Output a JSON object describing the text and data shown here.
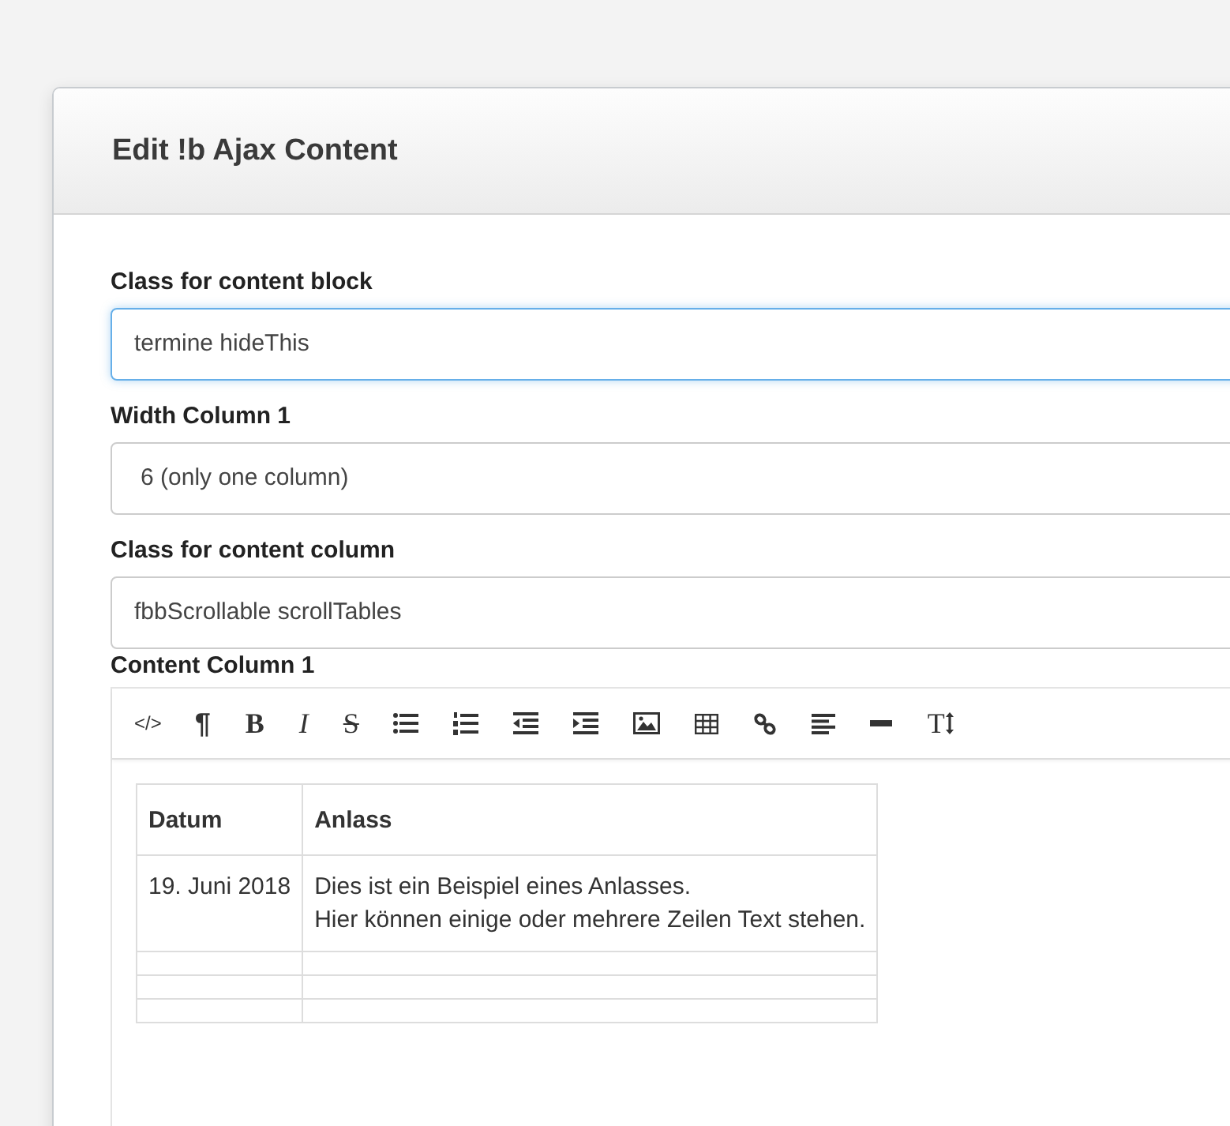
{
  "modal": {
    "title": "Edit !b Ajax Content"
  },
  "fields": [
    {
      "kind": "text",
      "label": "Class for content block",
      "value": "termine hideThis",
      "focused": true
    },
    {
      "kind": "select",
      "label": "Width Column 1",
      "value": "6 (only one column)",
      "focused": false
    },
    {
      "kind": "text",
      "label": "Class for content column",
      "value": "fbbScrollable scrollTables",
      "focused": false
    }
  ],
  "editor": {
    "label": "Content Column 1",
    "toolbar": [
      {
        "kind": "code",
        "label": "</>"
      },
      {
        "kind": "paragraph",
        "label": "¶"
      },
      {
        "kind": "bold",
        "label": "B"
      },
      {
        "kind": "italic",
        "label": "I"
      },
      {
        "kind": "strike",
        "label": "S"
      },
      {
        "kind": "bullet-list"
      },
      {
        "kind": "numbered-list"
      },
      {
        "kind": "outdent"
      },
      {
        "kind": "indent"
      },
      {
        "kind": "image"
      },
      {
        "kind": "table"
      },
      {
        "kind": "link"
      },
      {
        "kind": "align"
      },
      {
        "kind": "rule"
      },
      {
        "kind": "text-height",
        "label": "T"
      }
    ],
    "table": {
      "columns": [
        "Datum",
        "Anlass"
      ],
      "rows": [
        {
          "cells": [
            "19. Juni 2018",
            "Dies ist ein Beispiel eines Anlasses.\nHier können einige oder mehrere Zeilen Text stehen."
          ]
        }
      ]
    }
  }
}
